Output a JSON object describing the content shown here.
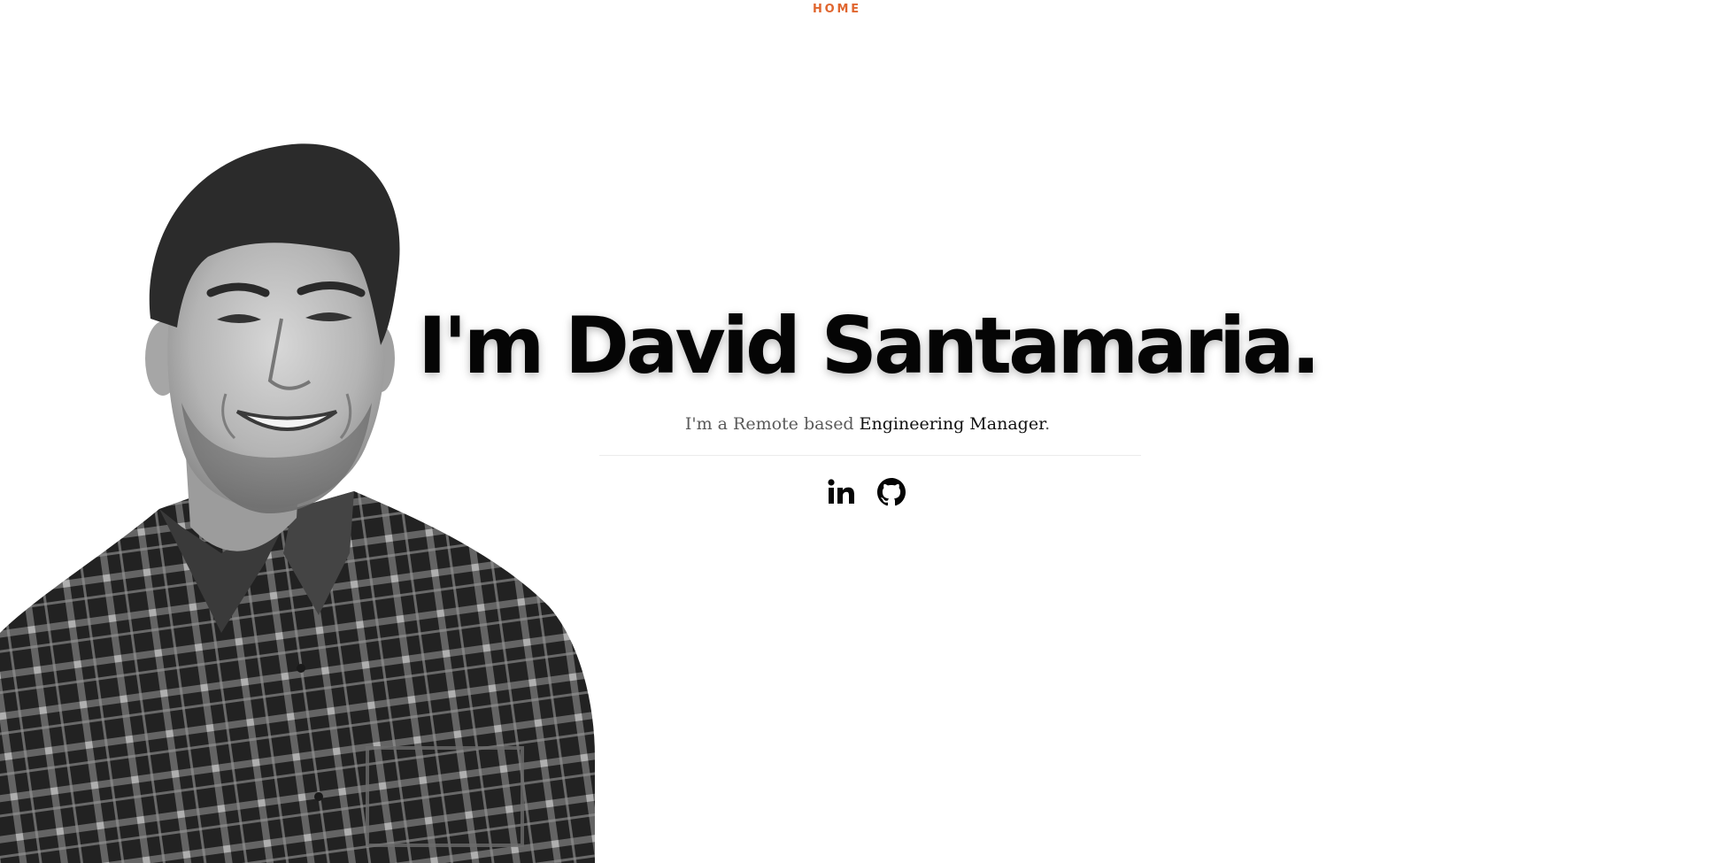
{
  "nav": {
    "items": [
      {
        "label": "HOME",
        "color": "#e0662f"
      }
    ]
  },
  "hero": {
    "title": "I'm David Santamaria.",
    "subtitle": {
      "prefix": "I'm a Remote based ",
      "role": "Engineering Manager",
      "suffix": "."
    },
    "social": [
      {
        "icon": "linkedin-icon",
        "label": "LinkedIn"
      },
      {
        "icon": "github-icon",
        "label": "GitHub"
      }
    ]
  },
  "portrait": {
    "subject": "photo-portrait",
    "style": "black-and-white"
  }
}
